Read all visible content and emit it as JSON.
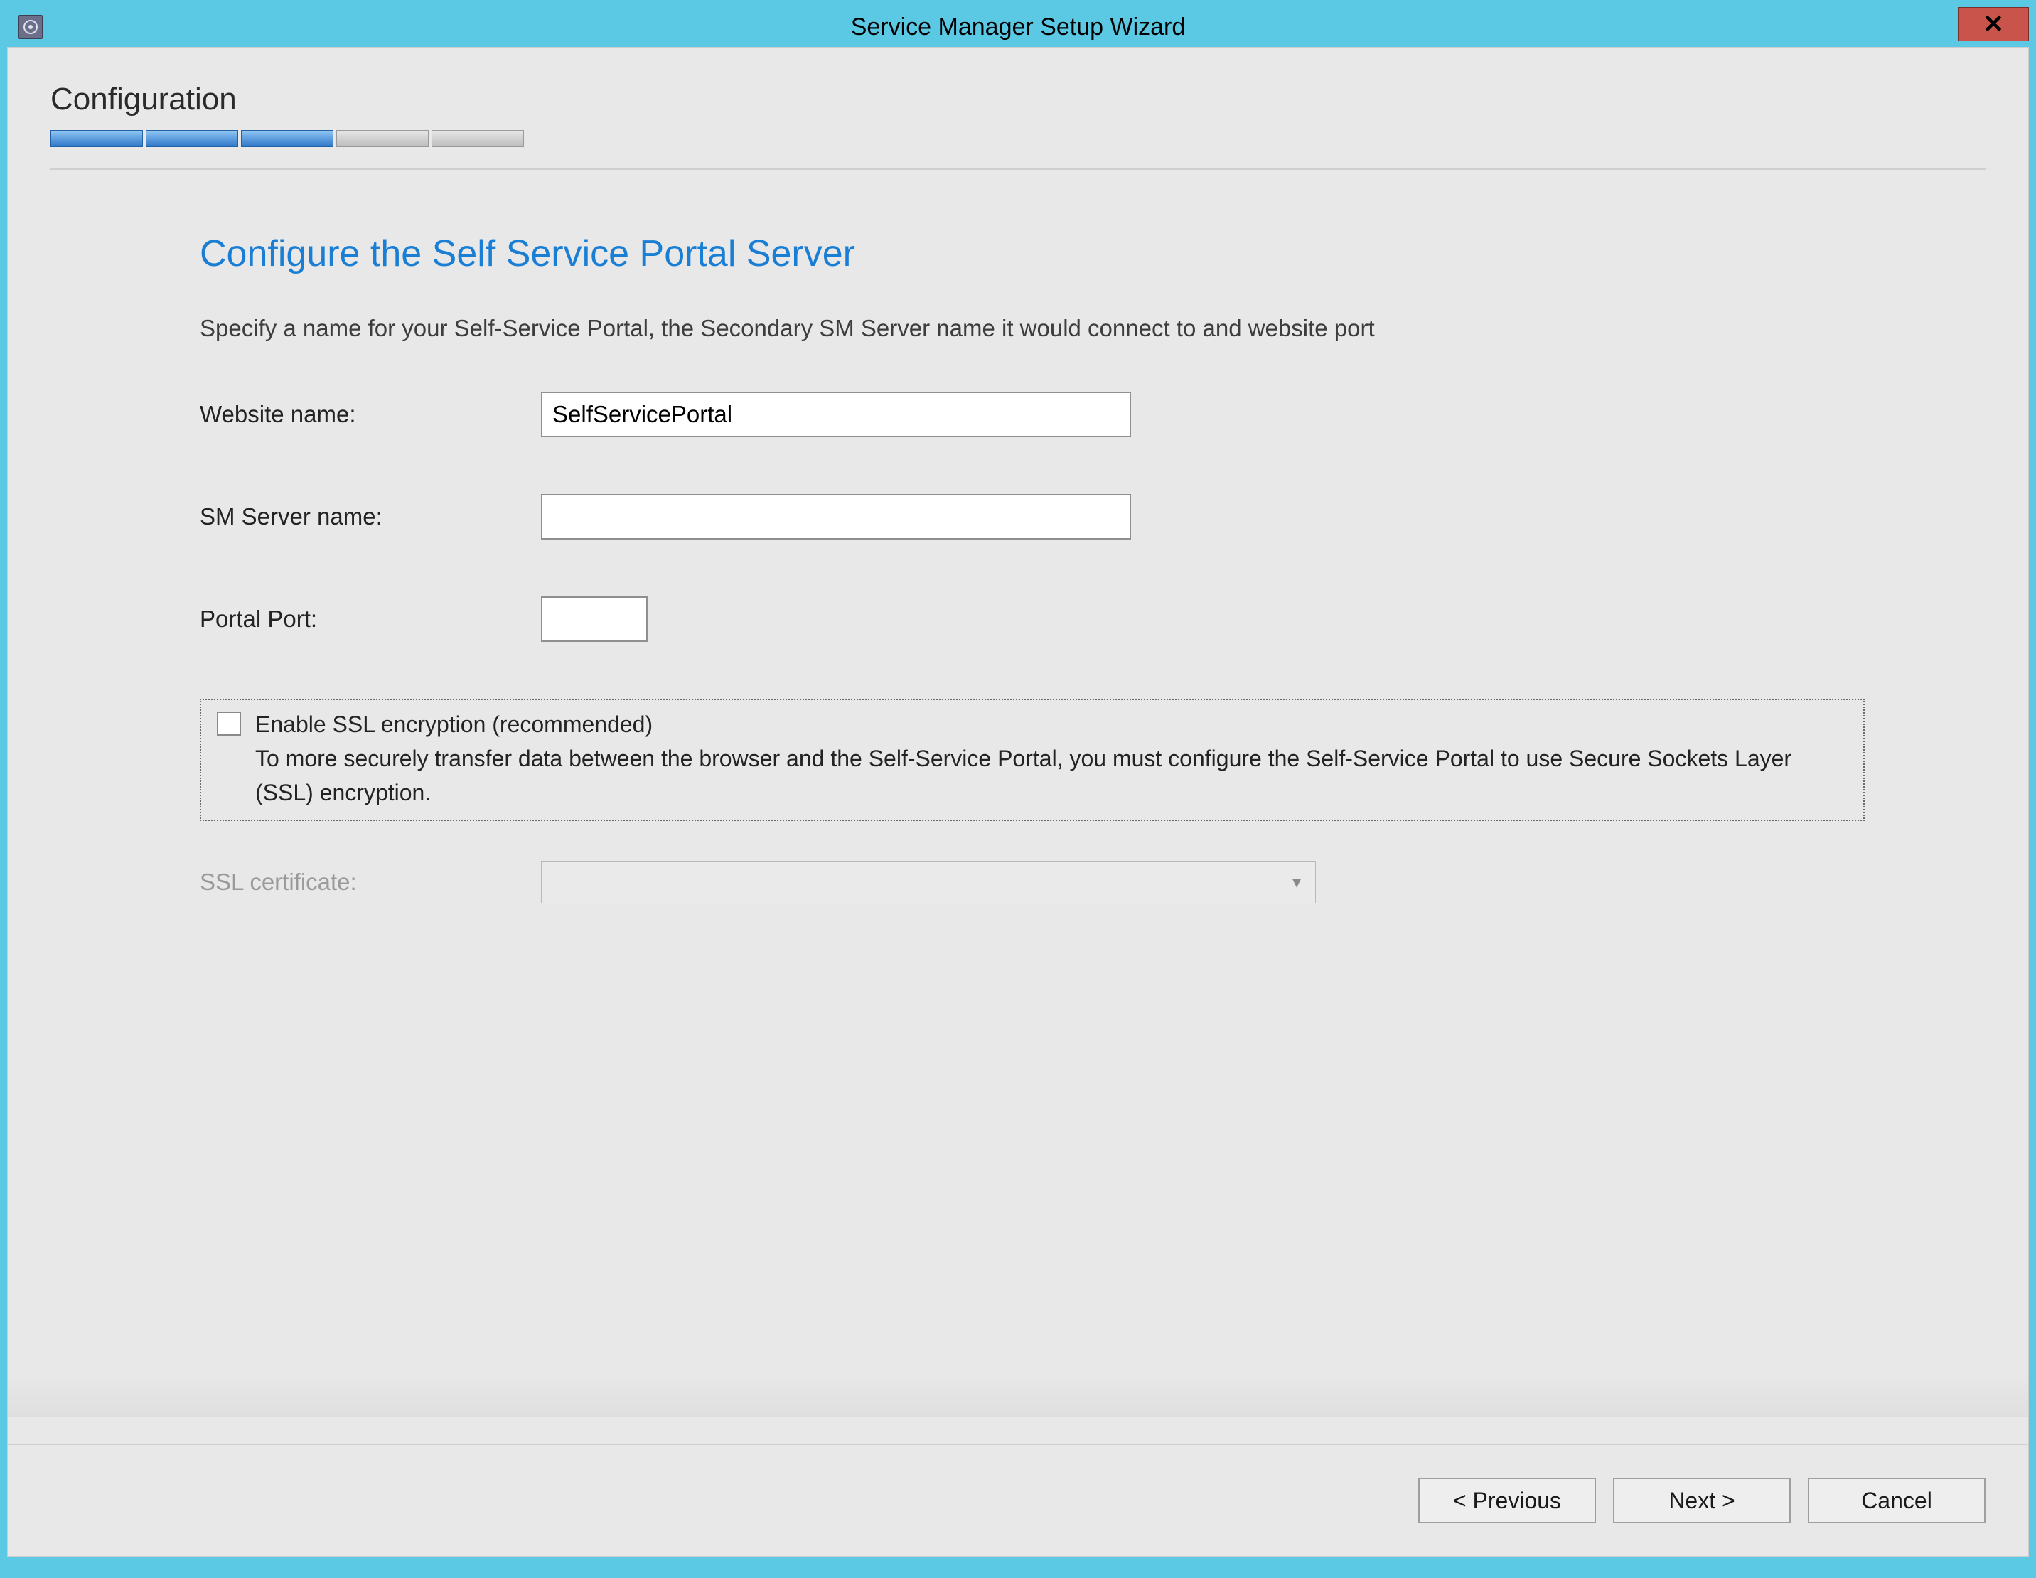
{
  "window": {
    "title": "Service Manager Setup Wizard"
  },
  "header": {
    "section_label": "Configuration",
    "progress": {
      "total": 5,
      "completed": 3
    }
  },
  "page": {
    "title": "Configure the Self Service Portal Server",
    "description": "Specify a name for your Self-Service Portal, the Secondary SM Server name it would connect to and website port"
  },
  "form": {
    "website_name": {
      "label": "Website name:",
      "value": "SelfServicePortal"
    },
    "sm_server_name": {
      "label": "SM Server name:",
      "value": ""
    },
    "portal_port": {
      "label": "Portal Port:",
      "value": ""
    },
    "ssl": {
      "checked": false,
      "title": "Enable SSL encryption (recommended)",
      "body": "To more securely transfer data between the browser and the Self-Service Portal, you must configure the Self-Service Portal to use Secure Sockets Layer (SSL) encryption."
    },
    "ssl_certificate": {
      "label": "SSL certificate:",
      "value": "",
      "enabled": false
    }
  },
  "footer": {
    "previous": "< Previous",
    "next": "Next >",
    "cancel": "Cancel"
  }
}
